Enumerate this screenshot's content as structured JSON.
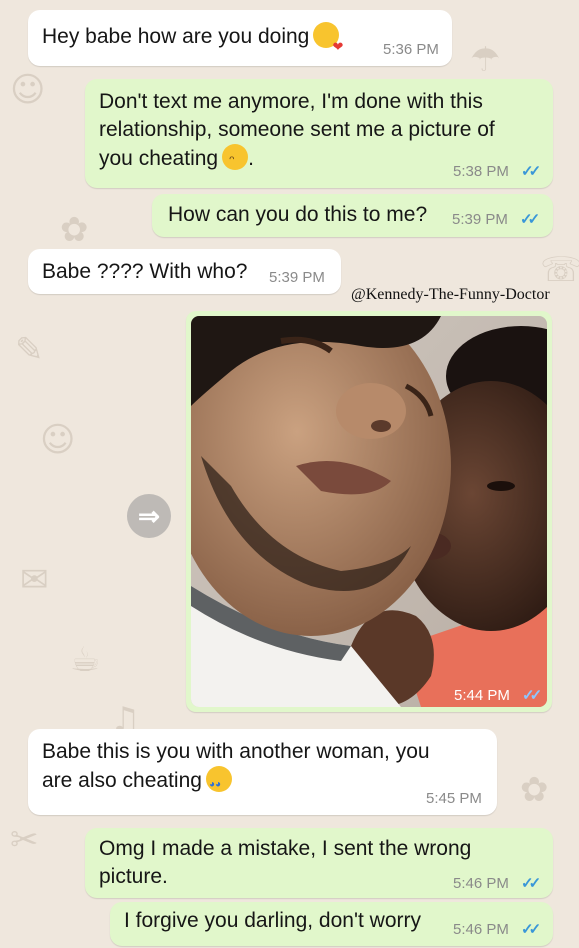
{
  "watermark": "@Kennedy-The-Funny-Doctor",
  "colors": {
    "incoming": "#ffffff",
    "outgoing": "#e1f7cb",
    "read_ticks": "#3a97d8",
    "wallpaper": "#efe7dd"
  },
  "messages": [
    {
      "direction": "in",
      "text": "Hey babe how are you doing",
      "emoji": "face-blowing-kiss",
      "time": "5:36 PM"
    },
    {
      "direction": "out",
      "lines": [
        "Don't text me anymore,  I'm done with this",
        "relationship, someone sent me a picture of",
        "you cheating"
      ],
      "emoji": "face-with-steam",
      "trailing": ".",
      "time": "5:38 PM",
      "status": "read"
    },
    {
      "direction": "out",
      "text": "How can you do this to me?",
      "time": "5:39 PM",
      "status": "read"
    },
    {
      "direction": "in",
      "text": "Babe ???? With who?",
      "time": "5:39 PM"
    },
    {
      "direction": "out",
      "type": "image",
      "image_description": "selfie-photo",
      "time": "5:44 PM",
      "status": "read"
    },
    {
      "direction": "in",
      "lines": [
        "Babe this is you with another woman,  you",
        "are also cheating"
      ],
      "emoji": "loudly-crying-face",
      "time": "5:45 PM"
    },
    {
      "direction": "out",
      "lines": [
        "Omg I made a mistake,  I sent the wrong",
        "picture."
      ],
      "time": "5:46 PM",
      "status": "read"
    },
    {
      "direction": "out",
      "text": "I forgive you darling,  don't worry",
      "time": "5:46 PM",
      "status": "read"
    }
  ],
  "ticks_glyph": "✓✓",
  "forward_glyph": "⇒"
}
